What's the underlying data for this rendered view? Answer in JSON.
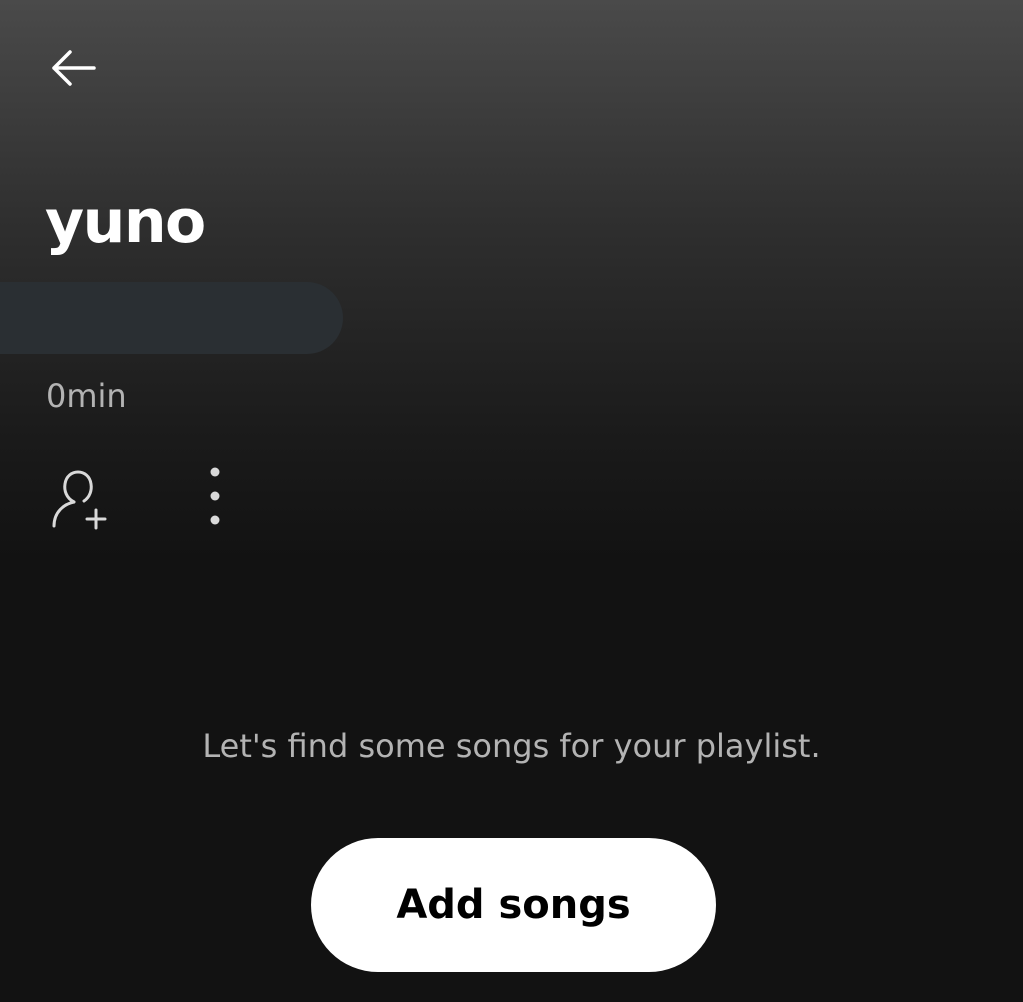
{
  "header": {
    "back_icon": "arrow-left-icon"
  },
  "playlist": {
    "title": "yuno",
    "duration": "0min"
  },
  "actions": {
    "add_user_icon": "person-plus-icon",
    "more_icon": "more-vertical-icon"
  },
  "empty_state": {
    "message": "Let's find some songs for your playlist.",
    "button_label": "Add songs"
  },
  "colors": {
    "background": "#121212",
    "text_primary": "#ffffff",
    "text_secondary": "#b3b3b3",
    "pill": "#2a2f33",
    "button_bg": "#ffffff",
    "button_text": "#000000"
  }
}
